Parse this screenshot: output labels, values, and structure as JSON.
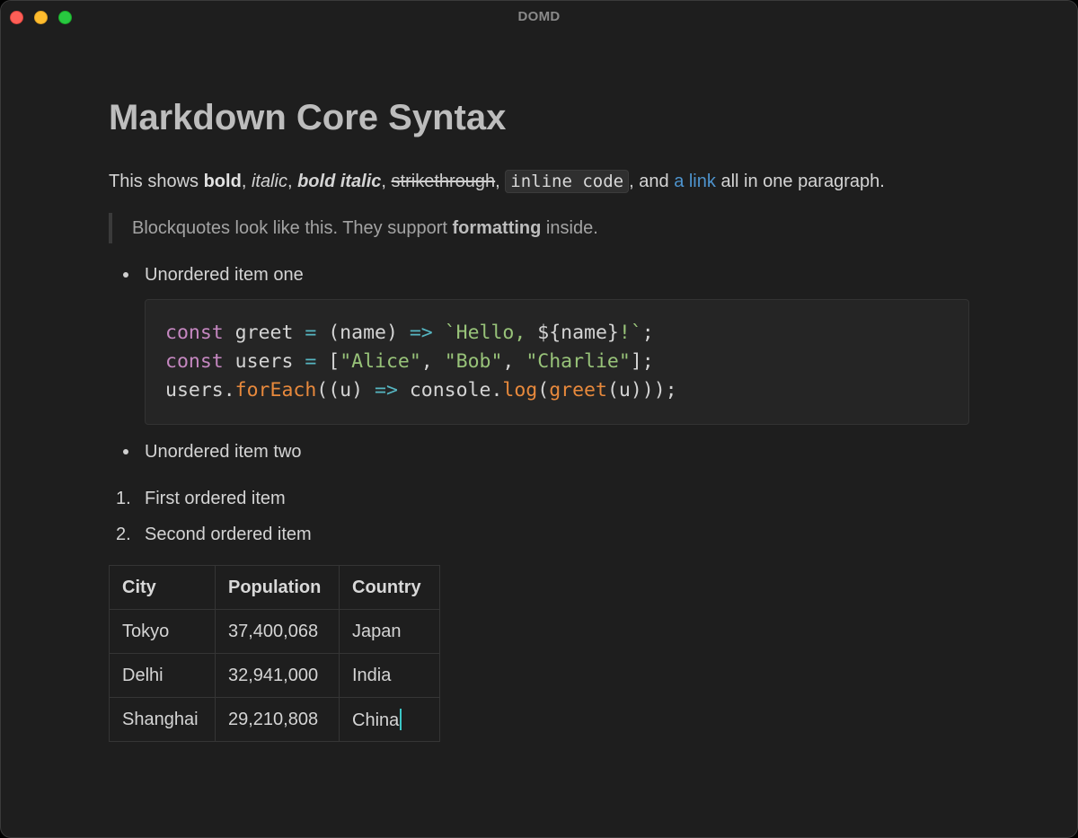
{
  "window": {
    "title": "DOMD"
  },
  "doc": {
    "heading": "Markdown Core Syntax",
    "paragraph": {
      "t1": "This shows ",
      "bold": "bold",
      "t2": ", ",
      "italic": "italic",
      "t3": ", ",
      "bold_italic": "bold italic",
      "t4": ", ",
      "strike": "strikethrough",
      "t5": ", ",
      "code": "inline code",
      "t6": ", and ",
      "link": "a link",
      "t7": " all in one paragraph."
    },
    "blockquote": {
      "t1": "Blockquotes look like this. They support ",
      "bold": "formatting",
      "t2": " inside."
    },
    "unordered": [
      "Unordered item one",
      "Unordered item two"
    ],
    "code_lines": [
      "const greet = (name) => `Hello, ${name}!`;",
      "const users = [\"Alice\", \"Bob\", \"Charlie\"];",
      "users.forEach((u) => console.log(greet(u)));"
    ],
    "ordered": [
      {
        "num": "1.",
        "text": "First ordered item"
      },
      {
        "num": "2.",
        "text": "Second ordered item"
      }
    ],
    "table": {
      "headers": [
        "City",
        "Population",
        "Country"
      ],
      "rows": [
        [
          "Tokyo",
          "37,400,068",
          "Japan"
        ],
        [
          "Delhi",
          "32,941,000",
          "India"
        ],
        [
          "Shanghai",
          "29,210,808",
          "China"
        ]
      ]
    }
  },
  "colors": {
    "background": "#1e1e1e",
    "link": "#4e94ce",
    "keyword": "#c587c0",
    "string": "#98c379",
    "operator": "#56b6c2",
    "function": "#e8893c",
    "caret": "#3bc5c5"
  }
}
